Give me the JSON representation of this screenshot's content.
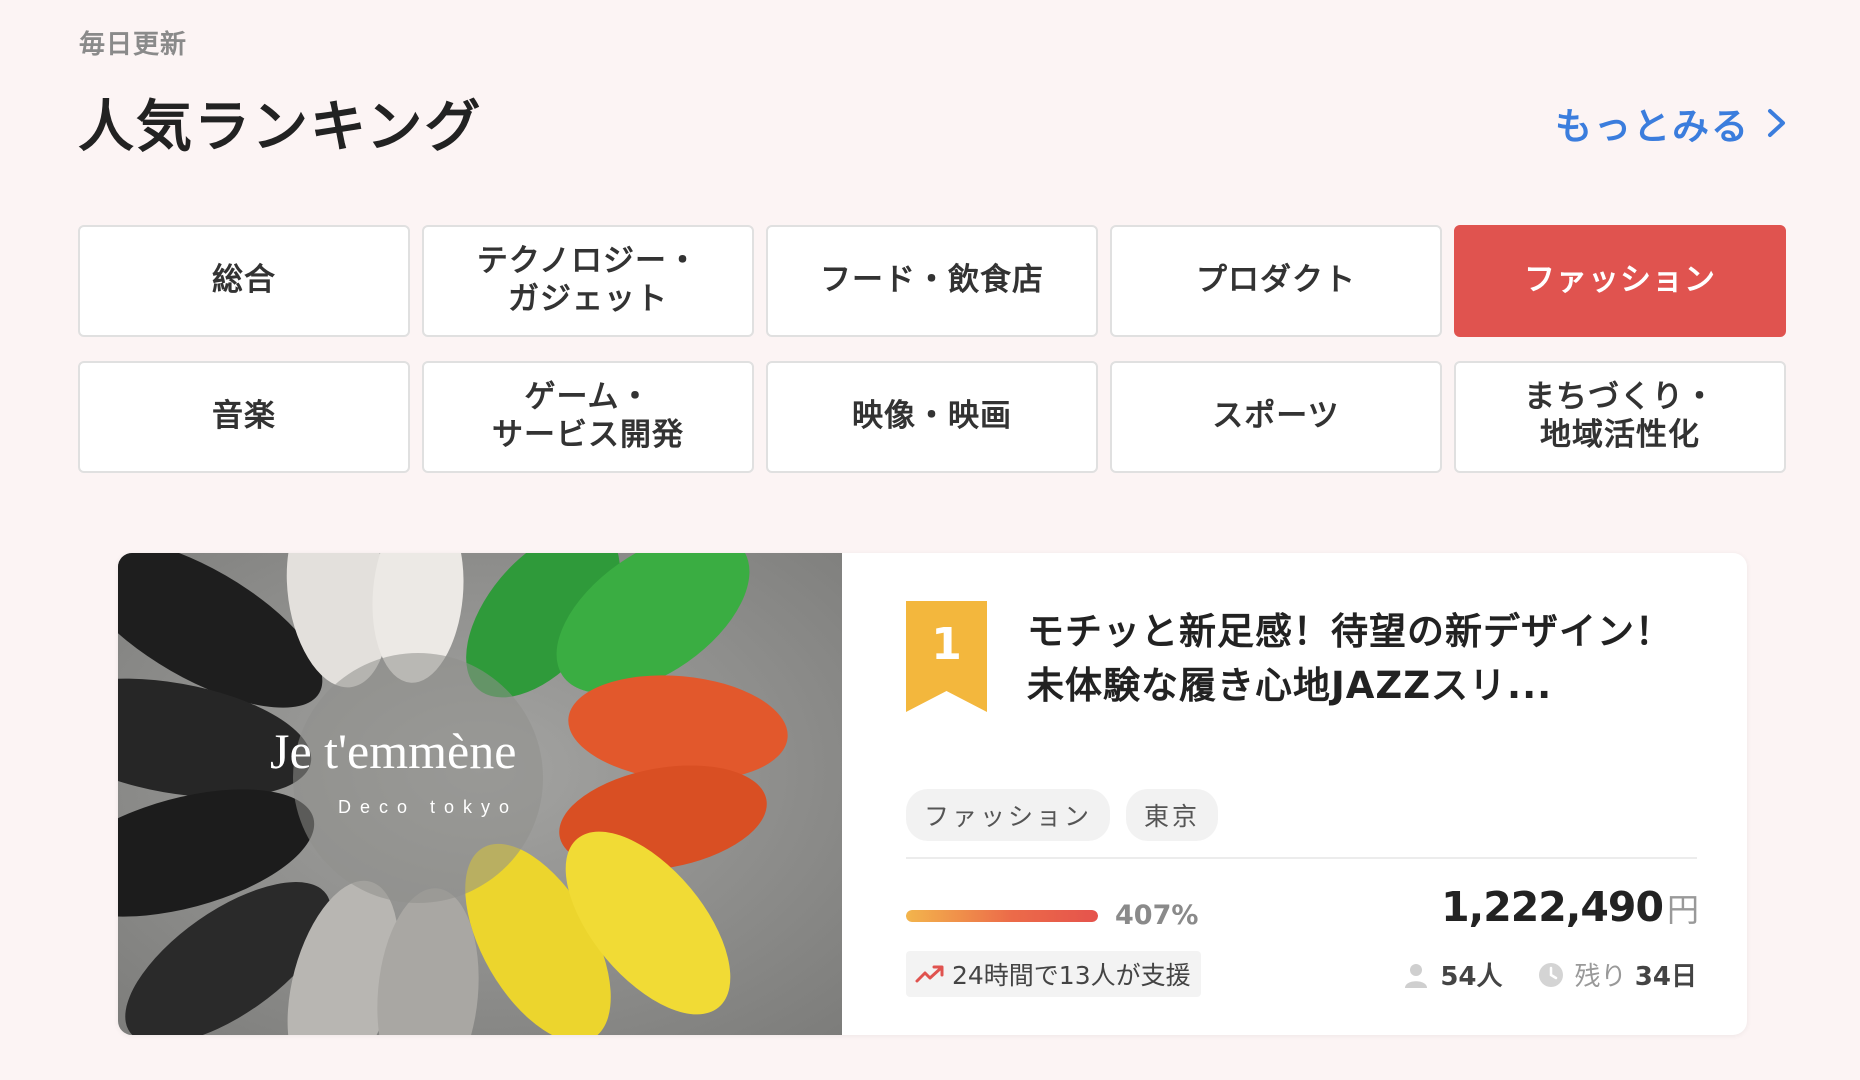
{
  "header": {
    "eyebrow": "毎日更新",
    "title": "人気ランキング",
    "more_label": "もっとみる"
  },
  "categories": [
    {
      "label": "総合",
      "active": false
    },
    {
      "label": "テクノロジー・\nガジェット",
      "active": false
    },
    {
      "label": "フード・飲食店",
      "active": false
    },
    {
      "label": "プロダクト",
      "active": false
    },
    {
      "label": "ファッション",
      "active": true
    },
    {
      "label": "音楽",
      "active": false
    },
    {
      "label": "ゲーム・\nサービス開発",
      "active": false
    },
    {
      "label": "映像・映画",
      "active": false
    },
    {
      "label": "スポーツ",
      "active": false
    },
    {
      "label": "まちづくり・\n地域活性化",
      "active": false
    }
  ],
  "project": {
    "rank": "1",
    "title": "モチッと新足感！待望の新デザイン！未体験な履き心地JAZZスリ...",
    "image_logo": "Je t'emmène",
    "image_sub": "Deco tokyo",
    "tags": [
      "ファッション",
      "東京"
    ],
    "progress_percent": 407,
    "progress_label": "407%",
    "amount": "1,222,490",
    "amount_unit": "円",
    "trend_text": "24時間で13人が支援",
    "supporters": "54",
    "supporters_unit": "人",
    "remaining_prefix": "残り",
    "remaining_days": "34",
    "remaining_unit": "日"
  },
  "colors": {
    "accent_red": "#e0534f",
    "link_blue": "#3b7ddd",
    "badge_gold": "#f3b73d",
    "background": "#fcf4f4"
  },
  "icons": {
    "more": "chevron-right-icon",
    "trend": "trending-up-icon",
    "supporters": "person-icon",
    "remaining": "clock-icon"
  }
}
